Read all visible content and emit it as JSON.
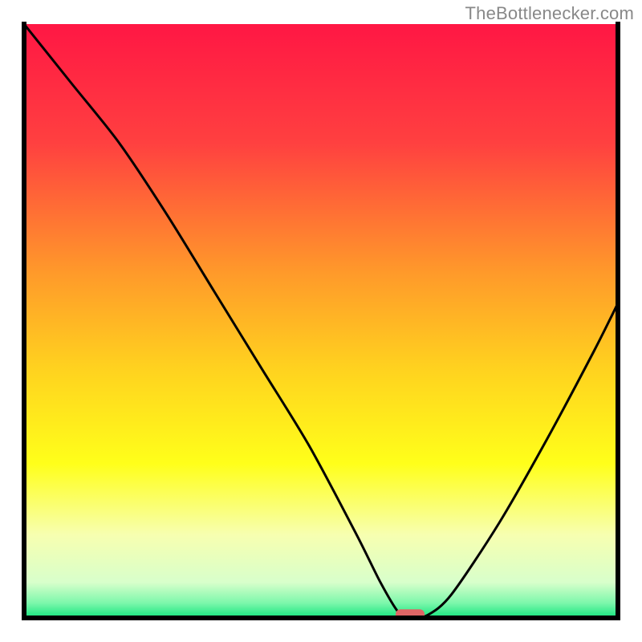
{
  "watermark": "TheBottlenecker.com",
  "chart_data": {
    "type": "line",
    "title": "",
    "xlabel": "",
    "ylabel": "",
    "xlim": [
      0,
      100
    ],
    "ylim": [
      0,
      100
    ],
    "x": [
      0,
      8,
      16,
      24,
      32,
      40,
      48,
      56,
      60,
      63,
      65,
      68,
      72,
      80,
      88,
      96,
      100
    ],
    "values": [
      100,
      90,
      80,
      68,
      55,
      42,
      29,
      14,
      6,
      1,
      0,
      0.5,
      4,
      16,
      30,
      45,
      53
    ],
    "marker": {
      "x": 65,
      "y": 0.5,
      "shape": "rounded-rect",
      "color": "#e06666"
    },
    "background_gradient": {
      "stops": [
        {
          "pos": 0.0,
          "color": "#ff1744"
        },
        {
          "pos": 0.2,
          "color": "#ff4040"
        },
        {
          "pos": 0.42,
          "color": "#ff9a2a"
        },
        {
          "pos": 0.58,
          "color": "#ffd21f"
        },
        {
          "pos": 0.74,
          "color": "#ffff1a"
        },
        {
          "pos": 0.86,
          "color": "#f7ffb0"
        },
        {
          "pos": 0.94,
          "color": "#d8ffcb"
        },
        {
          "pos": 0.975,
          "color": "#7cf7ab"
        },
        {
          "pos": 1.0,
          "color": "#14e67e"
        }
      ]
    },
    "axes": {
      "left": true,
      "right": true,
      "top": false,
      "bottom": true,
      "color": "#000000",
      "width": 6
    }
  }
}
